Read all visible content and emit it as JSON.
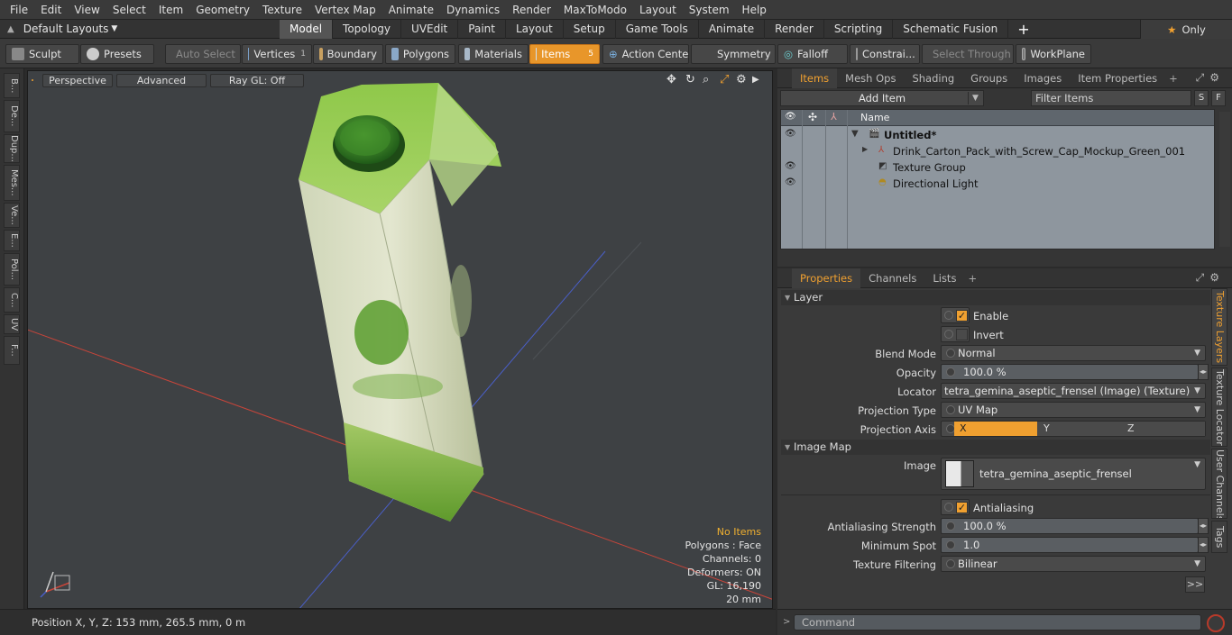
{
  "menubar": [
    "File",
    "Edit",
    "View",
    "Select",
    "Item",
    "Geometry",
    "Texture",
    "Vertex Map",
    "Animate",
    "Dynamics",
    "Render",
    "MaxToModo",
    "Layout",
    "System",
    "Help"
  ],
  "layout": {
    "dropdown": "Default Layouts",
    "tabs": [
      "Model",
      "Topology",
      "UVEdit",
      "Paint",
      "Layout",
      "Setup",
      "Game Tools",
      "Animate",
      "Render",
      "Scripting",
      "Schematic Fusion"
    ],
    "active_tab": "Model",
    "only_label": "Only"
  },
  "toolbar": {
    "sculpt": "Sculpt",
    "presets": "Presets",
    "auto_select": "Auto Select",
    "vertices": "Vertices",
    "vertices_count": "1",
    "boundary": "Boundary",
    "polygons": "Polygons",
    "materials": "Materials",
    "items": "Items",
    "items_count": "5",
    "action_center": "Action Center",
    "symmetry": "Symmetry",
    "falloff": "Falloff",
    "constraints": "Constrai...",
    "select_through": "Select Through",
    "workplane": "WorkPlane"
  },
  "left_strip": [
    "B...",
    "De...",
    "Dup...",
    "Mes...",
    "Ve...",
    "E...",
    "Pol...",
    "C...",
    "UV",
    "F..."
  ],
  "viewport": {
    "perspective": "Perspective",
    "advanced": "Advanced",
    "raygl": "Ray GL: Off",
    "stats": {
      "no_items": "No Items",
      "polygons": "Polygons : Face",
      "channels": "Channels: 0",
      "deformers": "Deformers: ON",
      "gl": "GL: 16,190",
      "scale": "20 mm"
    }
  },
  "status": {
    "position": "Position X, Y, Z:   153 mm, 265.5 mm, 0 m"
  },
  "items_panel": {
    "tabs": [
      "Items",
      "Mesh Ops",
      "Shading",
      "Groups",
      "Images",
      "Item Properties"
    ],
    "add_item": "Add Item",
    "filter_placeholder": "Filter Items",
    "s_btn": "S",
    "f_btn": "F",
    "col_name": "Name",
    "rows": [
      {
        "label": "Untitled*"
      },
      {
        "label": "Drink_Carton_Pack_with_Screw_Cap_Mockup_Green_001"
      },
      {
        "label": "Texture Group"
      },
      {
        "label": "Directional Light"
      }
    ]
  },
  "props_panel": {
    "tabs": [
      "Properties",
      "Channels",
      "Lists"
    ],
    "layer_section": "Layer",
    "enable": "Enable",
    "invert": "Invert",
    "blend_mode_label": "Blend Mode",
    "blend_mode": "Normal",
    "opacity_label": "Opacity",
    "opacity": "100.0 %",
    "locator_label": "Locator",
    "locator": "tetra_gemina_aseptic_frensel (Image) (Texture)",
    "proj_type_label": "Projection Type",
    "proj_type": "UV Map",
    "proj_axis_label": "Projection Axis",
    "axis_x": "X",
    "axis_y": "Y",
    "axis_z": "Z",
    "image_map_section": "Image Map",
    "image_label": "Image",
    "image_name": "tetra_gemina_aseptic_frensel",
    "antialiasing": "Antialiasing",
    "aa_strength_label": "Antialiasing Strength",
    "aa_strength": "100.0 %",
    "min_spot_label": "Minimum Spot",
    "min_spot": "1.0",
    "tex_filter_label": "Texture Filtering",
    "tex_filter": "Bilinear",
    "more": ">>"
  },
  "right_vtabs": [
    "Texture Layers",
    "Texture Locator",
    "User Channels",
    "Tags"
  ],
  "command": {
    "placeholder": "Command"
  },
  "colors": {
    "accent": "#f0a030",
    "viewport_bg": "#3e4144",
    "carton_green": "#6fae3a"
  }
}
